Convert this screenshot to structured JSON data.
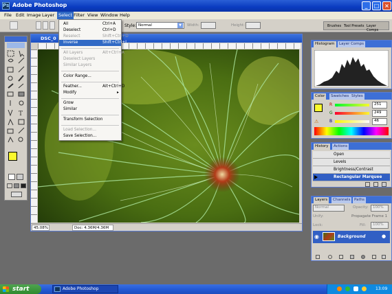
{
  "app": {
    "title": "Adobe Photoshop"
  },
  "menubar": {
    "items": [
      "File",
      "Edit",
      "Image",
      "Layer",
      "Select",
      "Filter",
      "View",
      "Window",
      "Help"
    ],
    "active": "Select"
  },
  "options": {
    "style_label": "Style:",
    "style_value": "Normal",
    "width_label": "Width:",
    "height_label": "Height:",
    "palette_tabs": [
      "Brushes",
      "Tool Presets",
      "Layer Comps"
    ]
  },
  "select_menu": {
    "items": [
      {
        "label": "All",
        "shortcut": "Ctrl+A",
        "disabled": false
      },
      {
        "label": "Deselect",
        "shortcut": "Ctrl+D",
        "disabled": false
      },
      {
        "label": "Reselect",
        "shortcut": "Shift+Ctrl+D",
        "disabled": true
      },
      {
        "label": "Inverse",
        "shortcut": "Shift+Ctrl+I",
        "disabled": false,
        "highlighted": true
      },
      {
        "label": "All Layers",
        "shortcut": "Alt+Ctrl+A",
        "disabled": true
      },
      {
        "label": "Deselect Layers",
        "shortcut": "",
        "disabled": true
      },
      {
        "label": "Similar Layers",
        "shortcut": "",
        "disabled": true
      },
      {
        "label": "Color Range...",
        "shortcut": "",
        "disabled": false
      },
      {
        "label": "Feather...",
        "shortcut": "Alt+Ctrl+D",
        "disabled": false
      },
      {
        "label": "Modify",
        "shortcut": "",
        "disabled": false,
        "submenu": true
      },
      {
        "label": "Grow",
        "shortcut": "",
        "disabled": false
      },
      {
        "label": "Similar",
        "shortcut": "",
        "disabled": false
      },
      {
        "label": "Transform Selection",
        "shortcut": "",
        "disabled": false
      },
      {
        "label": "Load Selection...",
        "shortcut": "",
        "disabled": true
      },
      {
        "label": "Save Selection...",
        "shortcut": "",
        "disabled": false
      }
    ]
  },
  "document": {
    "title": "DSC_0",
    "zoom": "45.08%",
    "doc_size": "Doc: 4.36M/4.36M"
  },
  "navigator": {
    "tabs": [
      "Histogram",
      "Layer Comps"
    ]
  },
  "color": {
    "tabs": [
      "Color",
      "Swatches",
      "Styles"
    ],
    "r": "251",
    "g": "249",
    "b": "46",
    "fg_color": "#fbf92e"
  },
  "history": {
    "tabs": [
      "History",
      "Actions"
    ],
    "items": [
      "Open",
      "Levels",
      "Brightness/Contrast",
      "Rectangular Marquee"
    ],
    "active": "Rectangular Marquee"
  },
  "layers": {
    "tabs": [
      "Layers",
      "Channels",
      "Paths"
    ],
    "blend_mode": "Normal",
    "opacity_label": "Opacity:",
    "opacity_value": "100%",
    "unify_label": "Unify:",
    "propagate_label": "Propagate Frame 1",
    "lock_label": "Lock:",
    "fill_label": "Fill:",
    "fill_value": "100%",
    "layer_name": "Background"
  },
  "taskbar": {
    "start": "start",
    "task": "Adobe Photoshop",
    "clock": "13:09"
  }
}
